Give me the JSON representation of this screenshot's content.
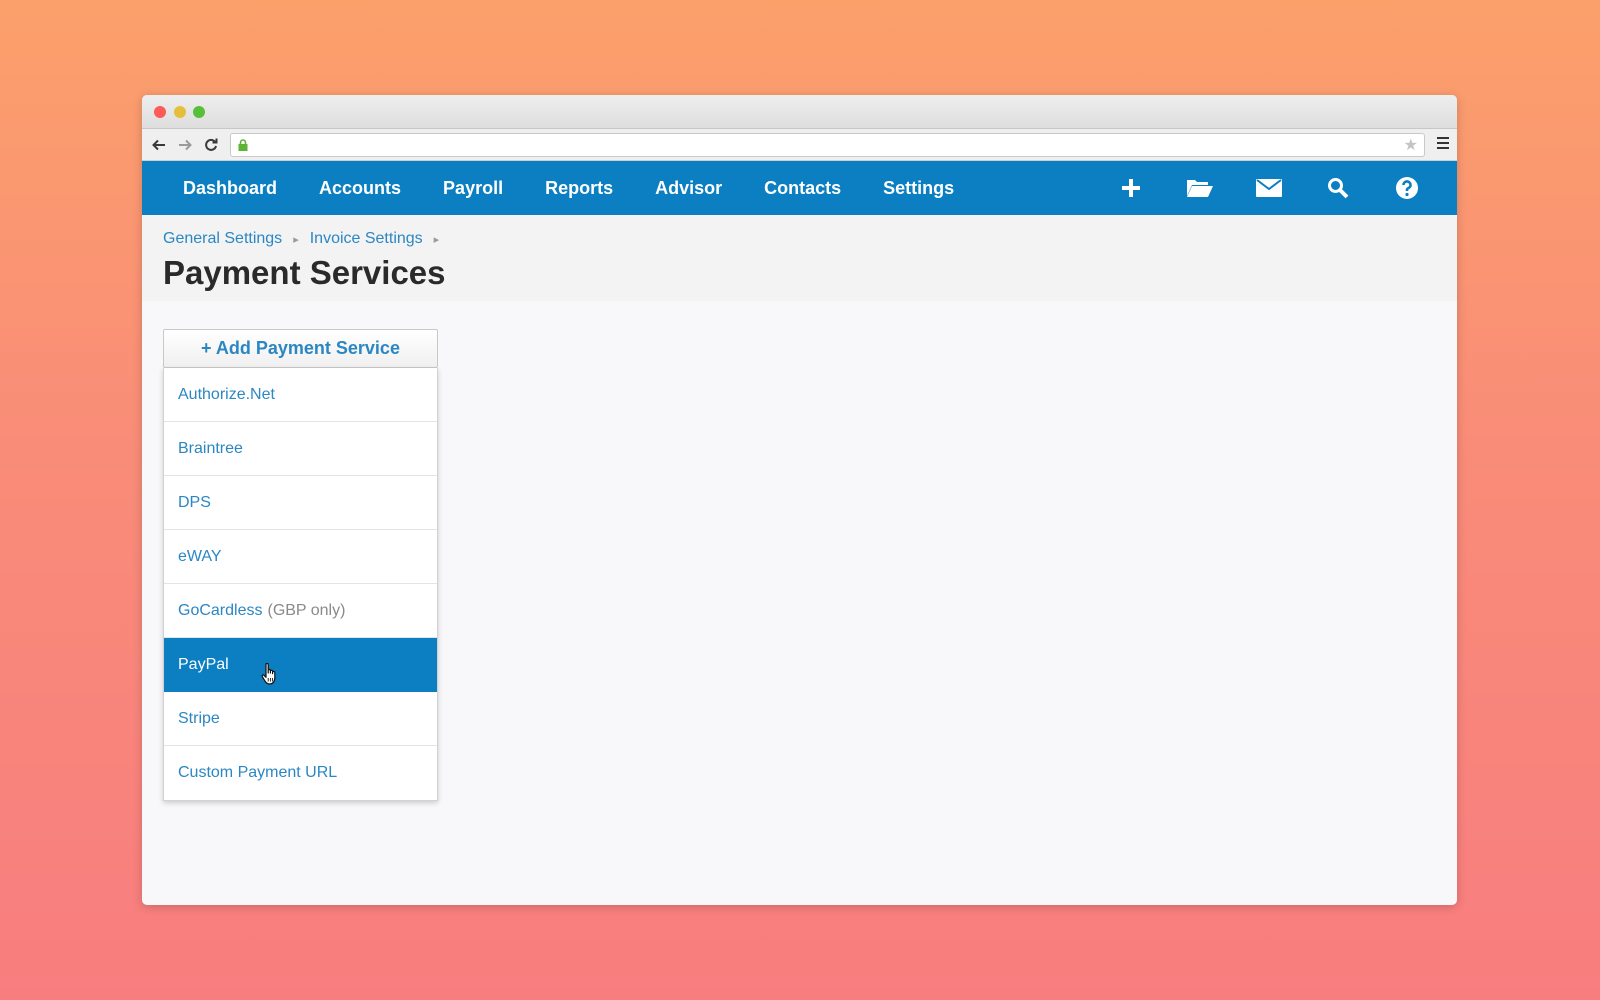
{
  "browser": {
    "url": ""
  },
  "nav": {
    "items": [
      "Dashboard",
      "Accounts",
      "Payroll",
      "Reports",
      "Advisor",
      "Contacts",
      "Settings"
    ]
  },
  "breadcrumb": {
    "items": [
      "General Settings",
      "Invoice Settings"
    ]
  },
  "page": {
    "title": "Payment Services"
  },
  "add_button": {
    "label": "+ Add Payment Service"
  },
  "dropdown": {
    "items": [
      {
        "label": "Authorize.Net",
        "note": ""
      },
      {
        "label": "Braintree",
        "note": ""
      },
      {
        "label": "DPS",
        "note": ""
      },
      {
        "label": "eWAY",
        "note": ""
      },
      {
        "label": "GoCardless",
        "note": "(GBP only)"
      },
      {
        "label": "PayPal",
        "note": ""
      },
      {
        "label": "Stripe",
        "note": ""
      },
      {
        "label": "Custom Payment URL",
        "note": ""
      }
    ],
    "selected": "PayPal"
  },
  "colors": {
    "nav_bg": "#0b7fc2",
    "link": "#2b87c4",
    "highlight": "#0b7fc2"
  }
}
